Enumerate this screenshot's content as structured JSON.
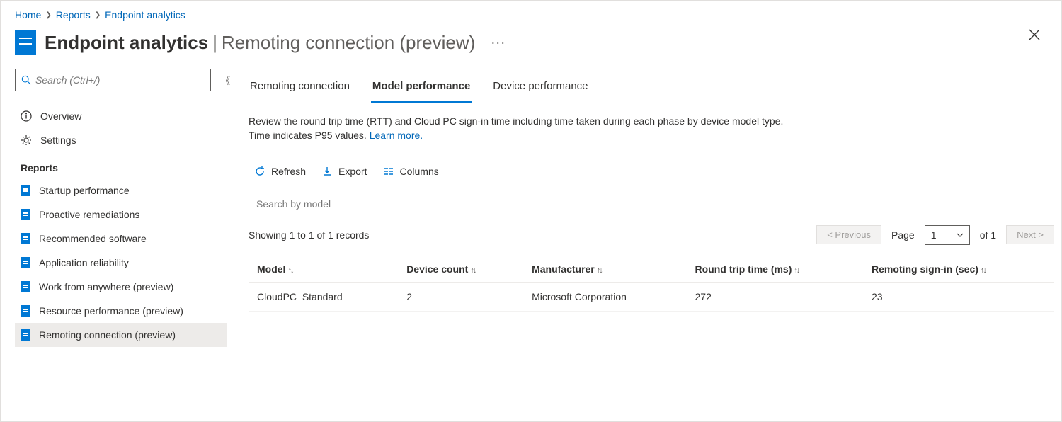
{
  "breadcrumb": {
    "home": "Home",
    "reports": "Reports",
    "current": "Endpoint analytics"
  },
  "title": {
    "main": "Endpoint analytics",
    "sub": "Remoting connection (preview)"
  },
  "sidebar": {
    "search_placeholder": "Search (Ctrl+/)",
    "overview": "Overview",
    "settings": "Settings",
    "section": "Reports",
    "items": [
      "Startup performance",
      "Proactive remediations",
      "Recommended software",
      "Application reliability",
      "Work from anywhere (preview)",
      "Resource performance (preview)",
      "Remoting connection (preview)"
    ]
  },
  "tabs": {
    "remoting": "Remoting connection",
    "model": "Model performance",
    "device": "Device performance"
  },
  "description": {
    "text": "Review the round trip time (RTT) and Cloud PC sign-in time including time taken during each phase by device model type. Time indicates P95 values.",
    "link": "Learn more."
  },
  "toolbar": {
    "refresh": "Refresh",
    "export": "Export",
    "columns": "Columns"
  },
  "search_placeholder": "Search by model",
  "records_text": "Showing 1 to 1 of 1 records",
  "pager": {
    "prev": "<  Previous",
    "page_label": "Page",
    "page_value": "1",
    "of_text": "of 1",
    "next": "Next  >"
  },
  "table": {
    "headers": {
      "model": "Model",
      "count": "Device count",
      "manufacturer": "Manufacturer",
      "rtt": "Round trip time (ms)",
      "signin": "Remoting sign-in (sec)"
    },
    "rows": [
      {
        "model": "CloudPC_Standard",
        "count": "2",
        "manufacturer": "Microsoft Corporation",
        "rtt": "272",
        "signin": "23"
      }
    ]
  }
}
